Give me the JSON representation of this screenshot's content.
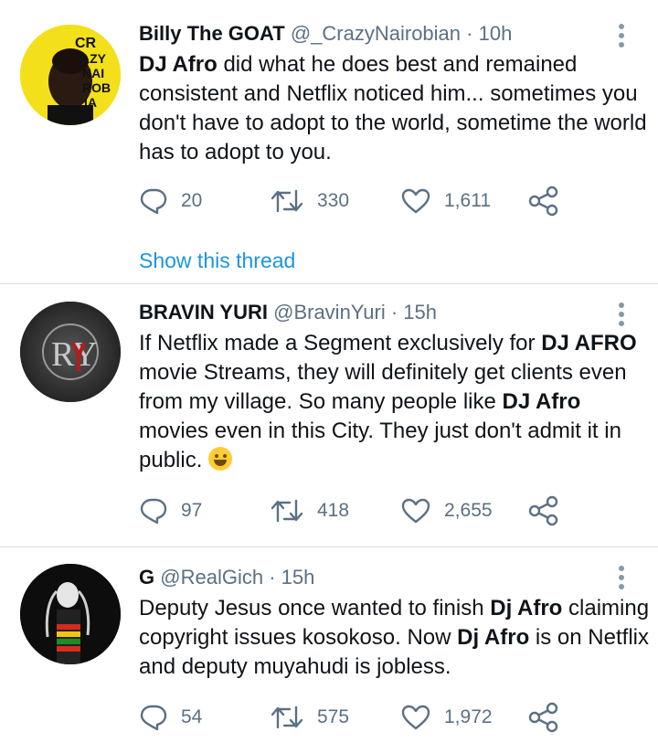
{
  "tweets": [
    {
      "name": "Billy The GOAT",
      "handle": "@_CrazyNairobian",
      "separator": "·",
      "time": "10h",
      "avatar_text": [
        "CR",
        "AZY",
        "NAI",
        "ROB",
        "IA",
        "N"
      ],
      "body": [
        {
          "t": "DJ Afro",
          "b": true
        },
        {
          "t": " did what he does best and remained consistent and Netflix noticed him... sometimes you don't have to adopt to the world, sometime the world has to adopt to you.",
          "b": false
        }
      ],
      "replies": "20",
      "retweets": "330",
      "likes": "1,611",
      "show_thread": "Show this thread"
    },
    {
      "name": "BRAVIN YURI",
      "handle": "@BravinYuri",
      "separator": "·",
      "time": "15h",
      "avatar_text": "RY",
      "body": [
        {
          "t": "If Netflix made a Segment exclusively for ",
          "b": false
        },
        {
          "t": "DJ AFRO",
          "b": true
        },
        {
          "t": " movie Streams, they will definitely get clients even from my village. So many people like ",
          "b": false
        },
        {
          "t": "DJ Afro",
          "b": true
        },
        {
          "t": " movies even in this City. They just don't admit it in public. ",
          "b": false
        }
      ],
      "emoji": "rolling-on-floor-laughing-emoji",
      "replies": "97",
      "retweets": "418",
      "likes": "2,655"
    },
    {
      "name": "G",
      "handle": "@RealGich",
      "separator": "·",
      "time": "15h",
      "body": [
        {
          "t": "Deputy Jesus once wanted to finish ",
          "b": false
        },
        {
          "t": "Dj Afro",
          "b": true
        },
        {
          "t": " claiming copyright issues kosokoso. Now ",
          "b": false
        },
        {
          "t": "Dj Afro",
          "b": true
        },
        {
          "t": " is on Netflix and deputy muyahudi is jobless.",
          "b": false
        }
      ],
      "replies": "54",
      "retweets": "575",
      "likes": "1,972"
    }
  ],
  "icons": {
    "reply": "reply-icon",
    "retweet": "retweet-icon",
    "like": "heart-icon",
    "share": "share-icon",
    "more": "more-options-icon"
  },
  "colors": {
    "link": "#1b95e0",
    "muted": "#5b7083",
    "text": "#0f1419",
    "divider": "#d8dee3"
  }
}
